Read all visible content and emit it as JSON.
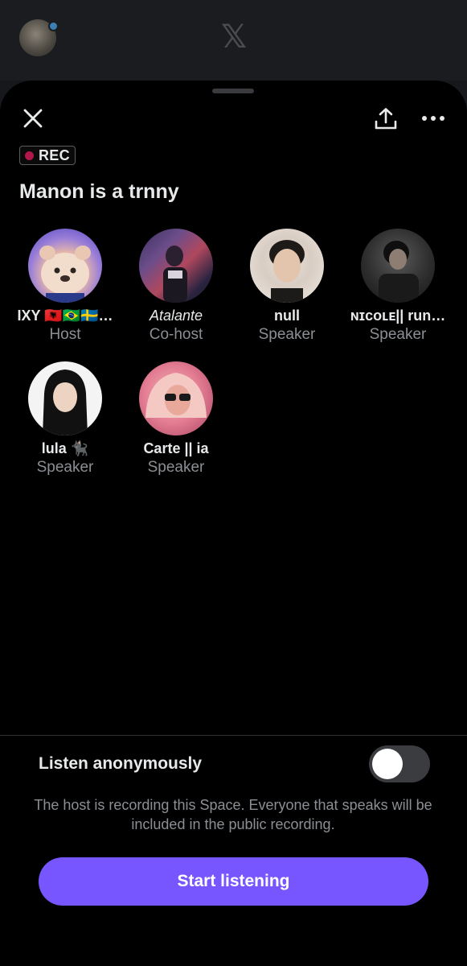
{
  "background": {
    "logo": "𝕏",
    "avatar_icon": "user-avatar"
  },
  "sheet": {
    "rec_label": "REC",
    "title": "Manon is a trnny",
    "participants": [
      {
        "name": "IXY 🇦🇱🇧🇷🇸🇪…",
        "role": "Host",
        "avatar": "pink-plush-avatar"
      },
      {
        "name": "Atalante",
        "role": "Co-host",
        "avatar": "neon-sign-avatar"
      },
      {
        "name": "null",
        "role": "Speaker",
        "avatar": "portrait-avatar"
      },
      {
        "name": "ɴɪᴄᴏʟᴇ|| run…",
        "role": "Speaker",
        "avatar": "dark-portrait-avatar"
      },
      {
        "name": "lula 🐈‍⬛",
        "role": "Speaker",
        "avatar": "portrait-avatar"
      },
      {
        "name": "Carte || ia",
        "role": "Speaker",
        "avatar": "pink-hair-avatar"
      }
    ],
    "listen_anonymously_label": "Listen anonymously",
    "listen_anonymously_on": false,
    "recording_notice": "The host is recording this Space. Everyone that speaks will be included in the public recording.",
    "start_button": "Start listening"
  },
  "colors": {
    "accent": "#7856ff",
    "rec_dot": "#b0174b",
    "muted_text": "#8b8f94"
  }
}
